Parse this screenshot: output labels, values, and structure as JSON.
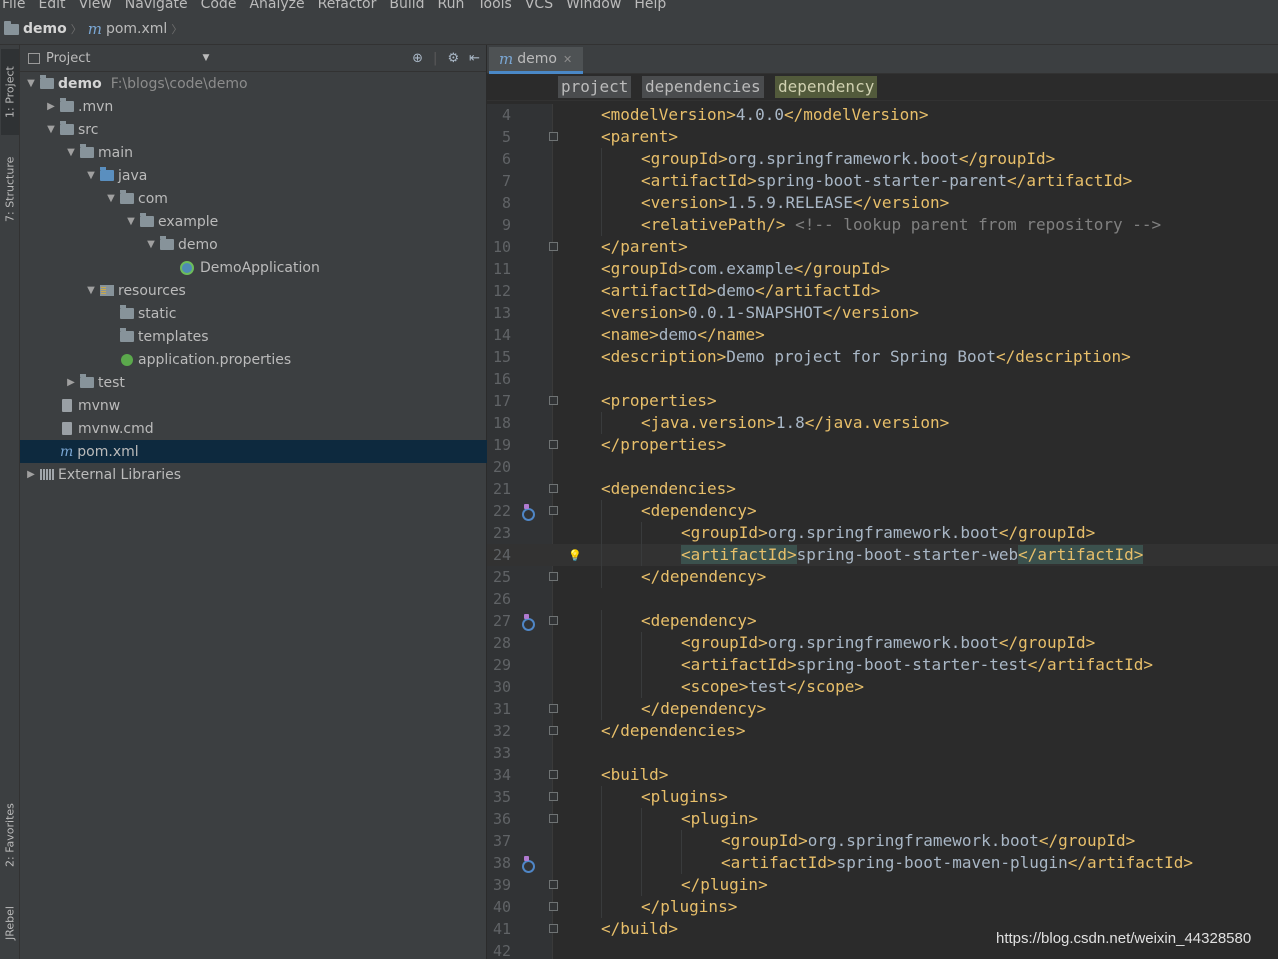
{
  "menu": [
    "File",
    "Edit",
    "View",
    "Navigate",
    "Code",
    "Analyze",
    "Refactor",
    "Build",
    "Run",
    "Tools",
    "VCS",
    "Window",
    "Help"
  ],
  "breadcrumb": {
    "project": "demo",
    "file": "pom.xml"
  },
  "tool_windows": {
    "project": "1: Project",
    "structure": "7: Structure",
    "favorites": "2: Favorites",
    "jrebel": "JRebel"
  },
  "project_panel": {
    "title": "Project",
    "tree": [
      {
        "label": "demo",
        "path": "F:\\blogs\\code\\demo",
        "arrow": "▼",
        "icon": "module-folder",
        "depth": 0
      },
      {
        "label": ".mvn",
        "arrow": "▶",
        "icon": "folder",
        "depth": 1
      },
      {
        "label": "src",
        "arrow": "▼",
        "icon": "folder",
        "depth": 1
      },
      {
        "label": "main",
        "arrow": "▼",
        "icon": "folder",
        "depth": 2
      },
      {
        "label": "java",
        "arrow": "▼",
        "icon": "source-folder",
        "depth": 3
      },
      {
        "label": "com",
        "arrow": "▼",
        "icon": "package",
        "depth": 4
      },
      {
        "label": "example",
        "arrow": "▼",
        "icon": "package",
        "depth": 5
      },
      {
        "label": "demo",
        "arrow": "▼",
        "icon": "package",
        "depth": 6
      },
      {
        "label": "DemoApplication",
        "arrow": "",
        "icon": "spring-boot-class",
        "depth": 7
      },
      {
        "label": "resources",
        "arrow": "▼",
        "icon": "resources-folder",
        "depth": 3
      },
      {
        "label": "static",
        "arrow": "",
        "icon": "folder",
        "depth": 4
      },
      {
        "label": "templates",
        "arrow": "",
        "icon": "folder",
        "depth": 4
      },
      {
        "label": "application.properties",
        "arrow": "",
        "icon": "spring-properties",
        "depth": 4
      },
      {
        "label": "test",
        "arrow": "▶",
        "icon": "folder",
        "depth": 2
      },
      {
        "label": "mvnw",
        "arrow": "",
        "icon": "file",
        "depth": 1
      },
      {
        "label": "mvnw.cmd",
        "arrow": "",
        "icon": "file",
        "depth": 1
      },
      {
        "label": "pom.xml",
        "arrow": "",
        "icon": "maven-file",
        "depth": 1,
        "selected": true
      },
      {
        "label": "External Libraries",
        "arrow": "▶",
        "icon": "libraries",
        "depth": 0
      }
    ]
  },
  "editor": {
    "tab": "demo",
    "xml_breadcrumbs": [
      "project",
      "dependencies",
      "dependency"
    ],
    "current_line": 24,
    "lines": [
      {
        "n": "4",
        "indent": 1,
        "parts": [
          [
            "tag",
            "<modelVersion>"
          ],
          [
            "val",
            "4.0.0"
          ],
          [
            "tag",
            "</modelVersion>"
          ]
        ]
      },
      {
        "n": "5",
        "indent": 1,
        "fold": true,
        "parts": [
          [
            "tag",
            "<parent>"
          ]
        ]
      },
      {
        "n": "6",
        "indent": 2,
        "parts": [
          [
            "tag",
            "<groupId>"
          ],
          [
            "val",
            "org.springframework.boot"
          ],
          [
            "tag",
            "</groupId>"
          ]
        ]
      },
      {
        "n": "7",
        "indent": 2,
        "parts": [
          [
            "tag",
            "<artifactId>"
          ],
          [
            "val",
            "spring-boot-starter-parent"
          ],
          [
            "tag",
            "</artifactId>"
          ]
        ]
      },
      {
        "n": "8",
        "indent": 2,
        "parts": [
          [
            "tag",
            "<version>"
          ],
          [
            "val",
            "1.5.9.RELEASE"
          ],
          [
            "tag",
            "</version>"
          ]
        ]
      },
      {
        "n": "9",
        "indent": 2,
        "parts": [
          [
            "tag",
            "<relativePath/>"
          ],
          [
            "val",
            " "
          ],
          [
            "cmt",
            "<!-- lookup parent from repository -->"
          ]
        ]
      },
      {
        "n": "10",
        "indent": 1,
        "fold": true,
        "parts": [
          [
            "tag",
            "</parent>"
          ]
        ]
      },
      {
        "n": "11",
        "indent": 1,
        "parts": [
          [
            "tag",
            "<groupId>"
          ],
          [
            "val",
            "com.example"
          ],
          [
            "tag",
            "</groupId>"
          ]
        ]
      },
      {
        "n": "12",
        "indent": 1,
        "parts": [
          [
            "tag",
            "<artifactId>"
          ],
          [
            "val",
            "demo"
          ],
          [
            "tag",
            "</artifactId>"
          ]
        ]
      },
      {
        "n": "13",
        "indent": 1,
        "parts": [
          [
            "tag",
            "<version>"
          ],
          [
            "val",
            "0.0.1-SNAPSHOT"
          ],
          [
            "tag",
            "</version>"
          ]
        ]
      },
      {
        "n": "14",
        "indent": 1,
        "parts": [
          [
            "tag",
            "<name>"
          ],
          [
            "val",
            "demo"
          ],
          [
            "tag",
            "</name>"
          ]
        ]
      },
      {
        "n": "15",
        "indent": 1,
        "parts": [
          [
            "tag",
            "<description>"
          ],
          [
            "val",
            "Demo project for Spring Boot"
          ],
          [
            "tag",
            "</description>"
          ]
        ]
      },
      {
        "n": "16",
        "indent": 0,
        "parts": []
      },
      {
        "n": "17",
        "indent": 1,
        "fold": true,
        "parts": [
          [
            "tag",
            "<properties>"
          ]
        ]
      },
      {
        "n": "18",
        "indent": 2,
        "parts": [
          [
            "tag",
            "<java.version>"
          ],
          [
            "val",
            "1.8"
          ],
          [
            "tag",
            "</java.version>"
          ]
        ]
      },
      {
        "n": "19",
        "indent": 1,
        "fold": true,
        "parts": [
          [
            "tag",
            "</properties>"
          ]
        ]
      },
      {
        "n": "20",
        "indent": 0,
        "parts": []
      },
      {
        "n": "21",
        "indent": 1,
        "fold": true,
        "parts": [
          [
            "tag",
            "<dependencies>"
          ]
        ]
      },
      {
        "n": "22",
        "indent": 2,
        "fold": true,
        "mark": true,
        "parts": [
          [
            "tag",
            "<dependency>"
          ]
        ]
      },
      {
        "n": "23",
        "indent": 3,
        "parts": [
          [
            "tag",
            "<groupId>"
          ],
          [
            "val",
            "org.springframework.boot"
          ],
          [
            "tag",
            "</groupId>"
          ]
        ]
      },
      {
        "n": "24",
        "indent": 3,
        "bulb": true,
        "parts": [
          [
            "taghl",
            "<artifactId>"
          ],
          [
            "val",
            "spring-boot-starter-web"
          ],
          [
            "taghl",
            "</artifactId>"
          ]
        ]
      },
      {
        "n": "25",
        "indent": 2,
        "fold": true,
        "parts": [
          [
            "tag",
            "</dependency>"
          ]
        ]
      },
      {
        "n": "26",
        "indent": 0,
        "parts": []
      },
      {
        "n": "27",
        "indent": 2,
        "fold": true,
        "mark": true,
        "parts": [
          [
            "tag",
            "<dependency>"
          ]
        ]
      },
      {
        "n": "28",
        "indent": 3,
        "parts": [
          [
            "tag",
            "<groupId>"
          ],
          [
            "val",
            "org.springframework.boot"
          ],
          [
            "tag",
            "</groupId>"
          ]
        ]
      },
      {
        "n": "29",
        "indent": 3,
        "parts": [
          [
            "tag",
            "<artifactId>"
          ],
          [
            "val",
            "spring-boot-starter-test"
          ],
          [
            "tag",
            "</artifactId>"
          ]
        ]
      },
      {
        "n": "30",
        "indent": 3,
        "parts": [
          [
            "tag",
            "<scope>"
          ],
          [
            "val",
            "test"
          ],
          [
            "tag",
            "</scope>"
          ]
        ]
      },
      {
        "n": "31",
        "indent": 2,
        "fold": true,
        "parts": [
          [
            "tag",
            "</dependency>"
          ]
        ]
      },
      {
        "n": "32",
        "indent": 1,
        "fold": true,
        "parts": [
          [
            "tag",
            "</dependencies>"
          ]
        ]
      },
      {
        "n": "33",
        "indent": 0,
        "parts": []
      },
      {
        "n": "34",
        "indent": 1,
        "fold": true,
        "parts": [
          [
            "tag",
            "<build>"
          ]
        ]
      },
      {
        "n": "35",
        "indent": 2,
        "fold": true,
        "parts": [
          [
            "tag",
            "<plugins>"
          ]
        ]
      },
      {
        "n": "36",
        "indent": 3,
        "fold": true,
        "parts": [
          [
            "tag",
            "<plugin>"
          ]
        ]
      },
      {
        "n": "37",
        "indent": 4,
        "parts": [
          [
            "tag",
            "<groupId>"
          ],
          [
            "val",
            "org.springframework.boot"
          ],
          [
            "tag",
            "</groupId>"
          ]
        ]
      },
      {
        "n": "38",
        "indent": 4,
        "mark": true,
        "parts": [
          [
            "tag",
            "<artifactId>"
          ],
          [
            "val",
            "spring-boot-maven-plugin"
          ],
          [
            "tag",
            "</artifactId>"
          ]
        ]
      },
      {
        "n": "39",
        "indent": 3,
        "fold": true,
        "parts": [
          [
            "tag",
            "</plugin>"
          ]
        ]
      },
      {
        "n": "40",
        "indent": 2,
        "fold": true,
        "parts": [
          [
            "tag",
            "</plugins>"
          ]
        ]
      },
      {
        "n": "41",
        "indent": 1,
        "fold": true,
        "parts": [
          [
            "tag",
            "</build>"
          ]
        ]
      },
      {
        "n": "42",
        "indent": 0,
        "parts": []
      }
    ]
  },
  "watermark": "https://blog.csdn.net/weixin_44328580",
  "colors": {
    "tag": "#e8bf6a",
    "value": "#a9b7c6",
    "comment": "#808080",
    "selection": "#0d293e",
    "background": "#2b2b2b"
  }
}
